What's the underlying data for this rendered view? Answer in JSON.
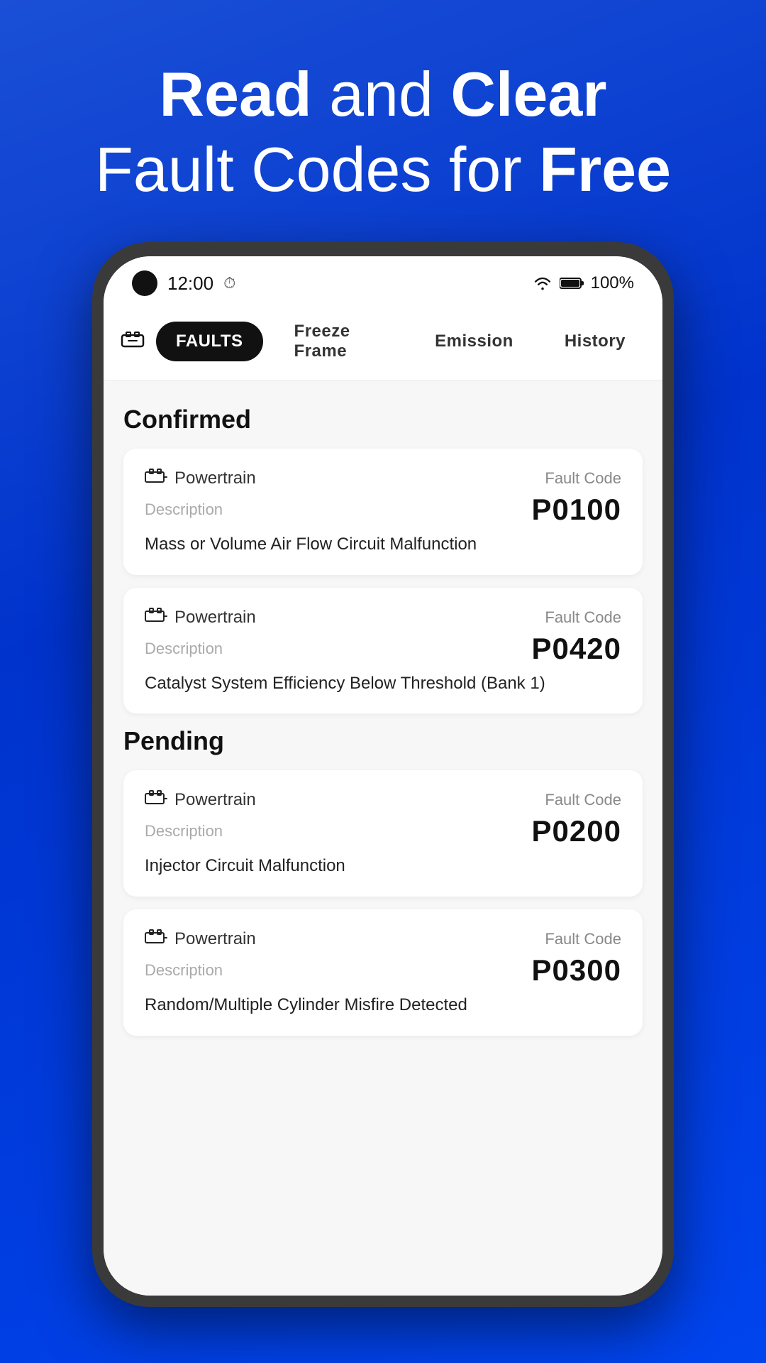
{
  "hero": {
    "line1_normal": "and ",
    "line1_bold1": "Read",
    "line1_bold2": "Clear",
    "line2_normal": "Fault Codes for ",
    "line2_bold": "Free"
  },
  "status_bar": {
    "time": "12:00",
    "battery": "100%"
  },
  "tabs": [
    {
      "id": "faults",
      "label": "Faults",
      "active": true
    },
    {
      "id": "freeze-frame",
      "label": "Freeze Frame",
      "active": false
    },
    {
      "id": "emission",
      "label": "Emission",
      "active": false
    },
    {
      "id": "history",
      "label": "History",
      "active": false
    }
  ],
  "sections": [
    {
      "title": "Confirmed",
      "faults": [
        {
          "system": "Powertrain",
          "fault_code_label": "Fault Code",
          "fault_code": "P0100",
          "description_label": "Description",
          "description": "Mass or Volume Air Flow Circuit Malfunction"
        },
        {
          "system": "Powertrain",
          "fault_code_label": "Fault Code",
          "fault_code": "P0420",
          "description_label": "Description",
          "description": "Catalyst System Efficiency Below Threshold (Bank 1)"
        }
      ]
    },
    {
      "title": "Pending",
      "faults": [
        {
          "system": "Powertrain",
          "fault_code_label": "Fault Code",
          "fault_code": "P0200",
          "description_label": "Description",
          "description": "Injector Circuit Malfunction"
        },
        {
          "system": "Powertrain",
          "fault_code_label": "Fault Code",
          "fault_code": "P0300",
          "description_label": "Description",
          "description": "Random/Multiple Cylinder Misfire Detected"
        }
      ]
    }
  ]
}
